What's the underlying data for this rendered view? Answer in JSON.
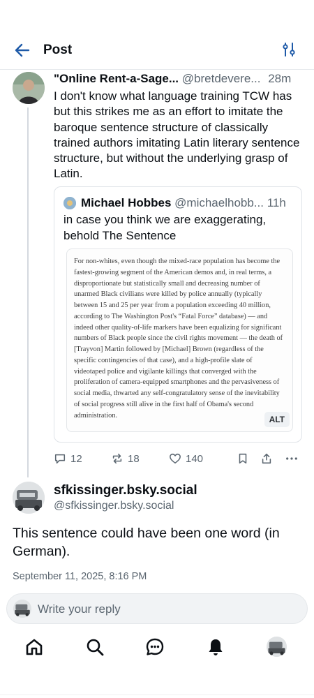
{
  "header": {
    "title": "Post",
    "back_icon": "arrow-left-icon",
    "filter_icon": "sliders-icon"
  },
  "post": {
    "author_name": "\"Online Rent-a-Sage...",
    "author_handle": "@bretdevere...",
    "time": "28m",
    "text": "I don't know what language training TCW has but this strikes me as an effort to imitate the baroque sentence structure of classically trained authors imitating Latin literary sentence structure, but without the underlying grasp of Latin.",
    "quote": {
      "author_name": "Michael Hobbes",
      "author_handle": "@michaelhobb...",
      "time": "11h",
      "text": "in case you think we are exaggerating, behold The Sentence",
      "image_text": "For non-whites, even though the mixed-race population has become the fastest-growing segment of the American demos and, in real terms, a disproportionate but statistically small and decreasing number of unarmed Black civilians were killed by police annually (typically between 15 and 25 per year from a population exceeding 40 million, according to The Washington Post's “Fatal Force” database) — and indeed other quality-of-life markers have been equalizing for significant numbers of Black people since the civil rights movement — the death of [Trayvon] Martin followed by [Michael] Brown (regardless of the specific contingencies of that case), and a high-profile slate of videotaped police and vigilante killings that converged with the proliferation of camera-equipped smartphones and the pervasiveness of social media, thwarted any self-congratulatory sense of the inevitability of social progress still alive in the first half of Obama's second administration.",
      "alt_label": "ALT"
    },
    "actions": {
      "replies": "12",
      "reposts": "18",
      "likes": "140"
    }
  },
  "reply_post": {
    "author_name": "sfkissinger.bsky.social",
    "author_handle": "@sfkissinger.bsky.social",
    "text": "This sentence could have been one word (in German).",
    "date": "September 11, 2025, 8:16 PM"
  },
  "composer": {
    "placeholder": "Write your reply"
  },
  "nav": {
    "items": [
      "home-icon",
      "search-icon",
      "chat-icon",
      "bell-icon",
      "profile-avatar"
    ]
  }
}
